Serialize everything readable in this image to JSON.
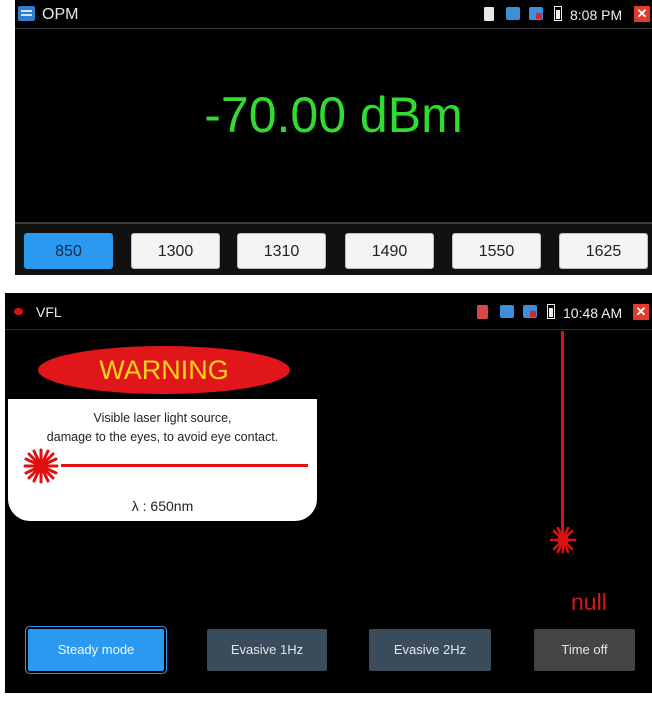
{
  "opm": {
    "title": "OPM",
    "time": "8:08 PM",
    "reading": "-70.00 dBm",
    "wavelengths": [
      "850",
      "1300",
      "1310",
      "1490",
      "1550",
      "1625"
    ],
    "selected_wavelength": "850",
    "status_icons": [
      "sd-card-icon",
      "usb-icon",
      "sim-icon",
      "battery-icon",
      "close-icon"
    ]
  },
  "vfl": {
    "title": "VFL",
    "time": "10:48 AM",
    "warning_title": "WARNING",
    "warning_line1": "Visible laser light source,",
    "warning_line2": "damage to the eyes, to avoid eye contact.",
    "wavelength_label": "λ : 650nm",
    "status_value": "null",
    "modes": {
      "steady": "Steady mode",
      "evasive_1hz": "Evasive 1Hz",
      "evasive_2hz": "Evasive 2Hz",
      "time_off": "Time off"
    },
    "selected_mode": "Steady mode",
    "status_icons": [
      "memory-icon",
      "usb-icon",
      "sim-icon",
      "battery-icon",
      "close-icon"
    ]
  },
  "colors": {
    "reading_green": "#2fdc2f",
    "accent_blue": "#2a9af0",
    "laser_red": "#e01010",
    "warning_yellow": "#ffd21a"
  }
}
